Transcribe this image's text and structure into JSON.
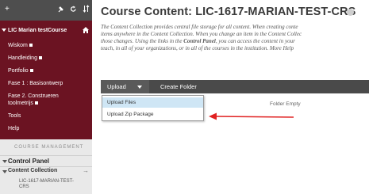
{
  "sidebar": {
    "course_title": "LIC Marian testCourse",
    "items": [
      {
        "label": "Wiskom",
        "square": true
      },
      {
        "label": "Handleiding",
        "square": true
      },
      {
        "label": "Portfolio",
        "square": true
      },
      {
        "label": "Fase 1 : Basisontwerp",
        "square": false
      },
      {
        "label": "Fase 2. Construeren",
        "square": false
      },
      {
        "label": "toolmetrijs",
        "square": true
      },
      {
        "label": "Tools",
        "square": false
      },
      {
        "label": "Help",
        "square": false
      }
    ],
    "management_header": "COURSE MANAGEMENT",
    "control_panel": "Control Panel",
    "content_collection": "Content Collection",
    "collection_sub": [
      "LIC-1617-MARIAN-TEST-",
      "CRS"
    ]
  },
  "main": {
    "title": "Course Content: LIC-1617-MARIAN-TEST-CRS",
    "description_lines": [
      "The Content Collection provides central file storage for all content. When creating conte",
      "items anywhere in the Content Collection. When you change an item in the Content Collec",
      "those changes. Using the links in the",
      "Control Panel",
      ", you can access the content in your",
      "teach, in all of your organizations, or in all of the courses in the institution. More Help"
    ],
    "toolbar": {
      "upload": "Upload",
      "create_folder": "Create Folder"
    },
    "dropdown": {
      "upload_files": "Upload Files",
      "upload_zip": "Upload Zip Package"
    },
    "empty_text": "Folder Empty"
  },
  "colors": {
    "sidebar_menu": "#6b1322",
    "toolbar": "#4a4a4a",
    "highlight": "#cfe6f5",
    "arrow": "#e02020"
  }
}
